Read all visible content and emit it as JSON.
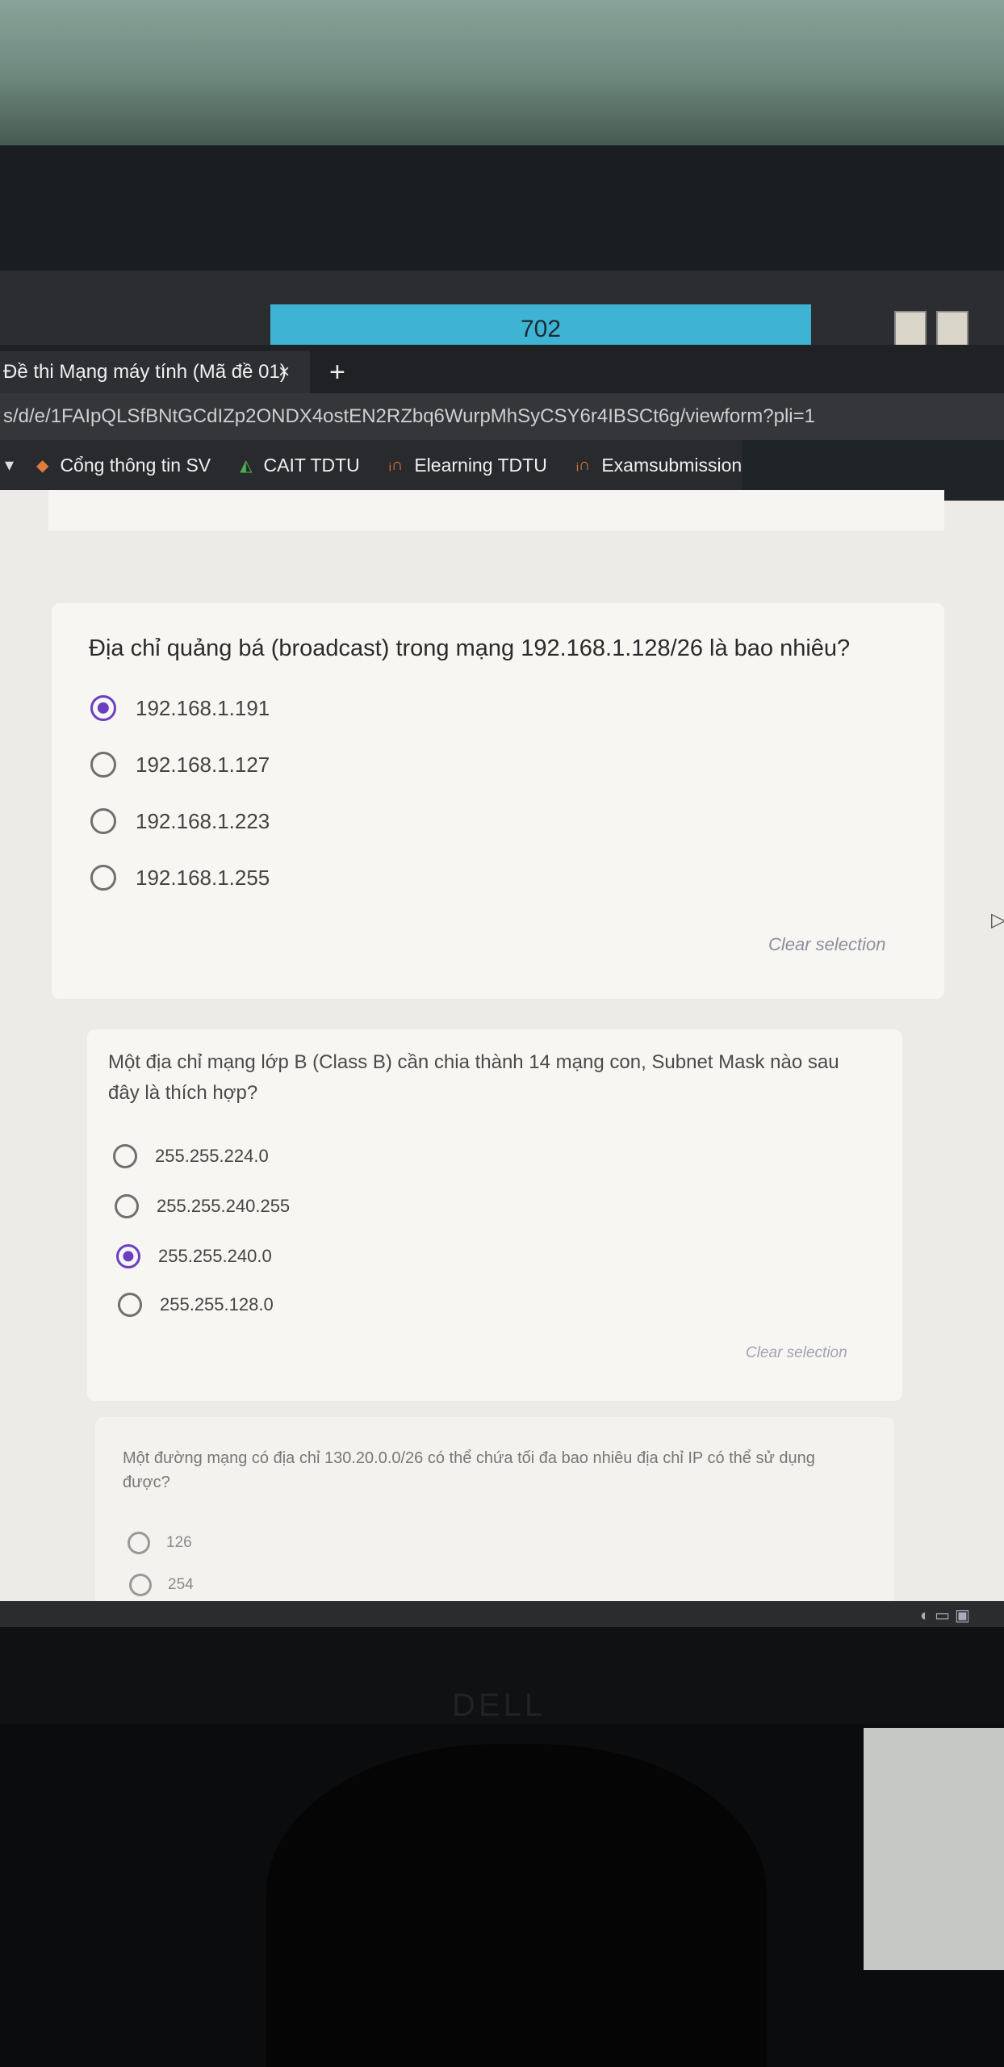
{
  "window": {
    "title": "702"
  },
  "browser": {
    "tab_title": "Đề thi Mạng máy tính (Mã đề 01)",
    "tab_close": "×",
    "new_tab": "+",
    "url": "s/d/e/1FAIpQLSfBNtGCdIZp2ONDX4ostEN2RZbq6WurpMhSyCSY6r4IBSCt6g/viewform?pli=1",
    "bookmarks": [
      {
        "label": "Cổng thông tin SV",
        "icon": "portal-icon"
      },
      {
        "label": "CAIT TDTU",
        "icon": "cait-icon"
      },
      {
        "label": "Elearning TDTU",
        "icon": "moodle-icon"
      },
      {
        "label": "Examsubmission",
        "icon": "moodle-icon"
      }
    ]
  },
  "form": {
    "clear_label": "Clear selection",
    "questions": [
      {
        "title": "Địa chỉ quảng bá (broadcast) trong mạng 192.168.1.128/26 là bao nhiêu?",
        "options": [
          "192.168.1.191",
          "192.168.1.127",
          "192.168.1.223",
          "192.168.1.255"
        ],
        "selected": "192.168.1.191"
      },
      {
        "title": "Một địa chỉ mạng lớp B (Class B) cần chia thành 14 mạng con, Subnet Mask nào sau đây là thích hợp?",
        "options": [
          "255.255.224.0",
          "255.255.240.255",
          "255.255.240.0",
          "255.255.128.0"
        ],
        "selected": "255.255.240.0"
      },
      {
        "title": "Một đường mạng có địa chỉ 130.20.0.0/26 có thể chứa tối đa bao nhiêu địa chỉ IP có thể sử dụng được?",
        "options": [
          "126",
          "254"
        ],
        "selected": null
      }
    ]
  },
  "colors": {
    "accent": "#6a3fc4",
    "title_bar": "#3fb3d3"
  },
  "monitor": {
    "brand": "DELL"
  }
}
